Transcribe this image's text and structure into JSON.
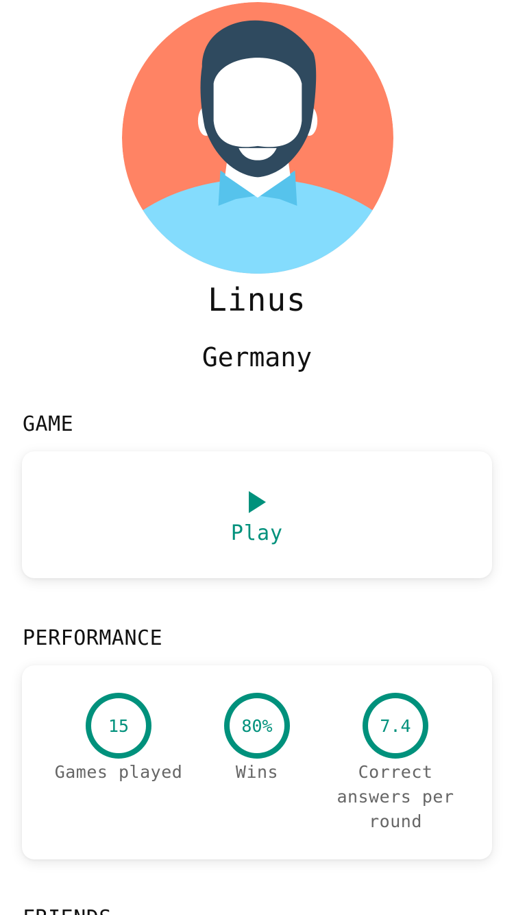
{
  "profile": {
    "name": "Linus",
    "country": "Germany"
  },
  "avatar": {
    "icon": "user-avatar-icon",
    "colors": {
      "background": "#ff8364",
      "shirt": "#84dcfd",
      "collar": "#56c3ec",
      "hair": "#2f4a5f",
      "skin": "#ffffff"
    }
  },
  "sections": {
    "game": "GAME",
    "performance": "PERFORMANCE",
    "friends": "FRIENDS"
  },
  "game": {
    "play_label": "Play",
    "play_icon": "play-icon"
  },
  "performance": {
    "stats": [
      {
        "value": "15",
        "label": "Games played"
      },
      {
        "value": "80%",
        "label": "Wins"
      },
      {
        "value": "7.4",
        "label": "Correct answers per round"
      }
    ]
  },
  "colors": {
    "accent": "#00917c",
    "muted_text": "#666666"
  }
}
